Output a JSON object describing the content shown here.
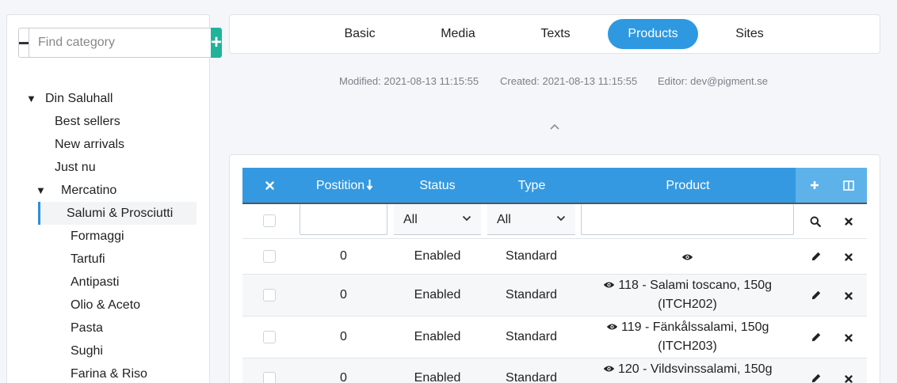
{
  "sidebar": {
    "search_placeholder": "Find category",
    "minus_label": "−",
    "plus_label": "+",
    "tree": [
      {
        "label": "Din Saluhall",
        "level": 0,
        "expanded": true
      },
      {
        "label": "Best sellers",
        "level": 1
      },
      {
        "label": "New arrivals",
        "level": 1
      },
      {
        "label": "Just nu",
        "level": 1
      },
      {
        "label": "Mercatino",
        "level": 1,
        "expanded": true
      },
      {
        "label": "Salumi & Prosciutti",
        "level": 2,
        "active": true
      },
      {
        "label": "Formaggi",
        "level": 2
      },
      {
        "label": "Tartufi",
        "level": 2
      },
      {
        "label": "Antipasti",
        "level": 2
      },
      {
        "label": "Olio & Aceto",
        "level": 2
      },
      {
        "label": "Pasta",
        "level": 2
      },
      {
        "label": "Sughi",
        "level": 2
      },
      {
        "label": "Farina & Riso",
        "level": 2
      }
    ]
  },
  "tabs": [
    {
      "label": "Basic"
    },
    {
      "label": "Media"
    },
    {
      "label": "Texts"
    },
    {
      "label": "Products",
      "active": true
    },
    {
      "label": "Sites"
    }
  ],
  "meta": {
    "modified": "Modified: 2021-08-13 11:15:55",
    "created": "Created: 2021-08-13 11:15:55",
    "editor": "Editor: dev@pigment.se"
  },
  "table": {
    "columns": {
      "position": "Postition",
      "status": "Status",
      "type": "Type",
      "product": "Product"
    },
    "filters": {
      "status": "All",
      "type": "All"
    },
    "rows": [
      {
        "position": "0",
        "status": "Enabled",
        "type": "Standard",
        "product_line1": "",
        "product_line2": ""
      },
      {
        "position": "0",
        "status": "Enabled",
        "type": "Standard",
        "product_line1": "118 - Salami toscano, 150g",
        "product_line2": "(ITCH202)"
      },
      {
        "position": "0",
        "status": "Enabled",
        "type": "Standard",
        "product_line1": "119 - Fänkålssalami, 150g",
        "product_line2": "(ITCH203)"
      },
      {
        "position": "0",
        "status": "Enabled",
        "type": "Standard",
        "product_line1": "120 - Vildsvinssalami, 150g",
        "product_line2": ""
      }
    ]
  },
  "colors": {
    "accent": "#2e98e0",
    "header": "#3499e0",
    "header_tools": "#5db2ea",
    "add": "#20b39b"
  },
  "icons": {
    "clear_selection": "times-icon",
    "sort": "sort-down-icon",
    "add": "plus-icon",
    "columns": "columns-icon",
    "search": "search-icon",
    "clear_filter": "times-icon",
    "view": "eye-icon",
    "edit": "pencil-icon",
    "delete": "times-icon"
  }
}
